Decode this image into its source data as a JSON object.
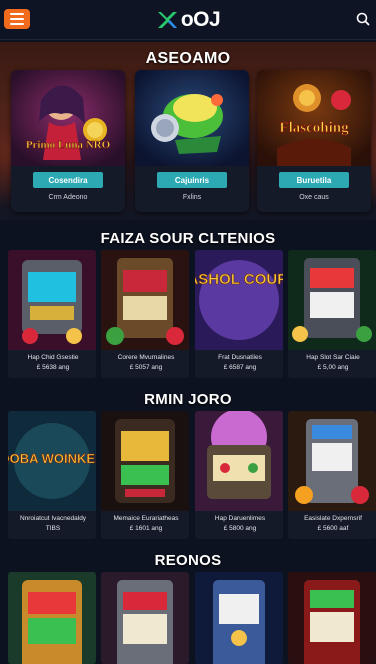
{
  "header": {
    "logo_text": "oOJ"
  },
  "sections": {
    "featured_title": "ASEOAMO",
    "row1_title": "FAIZA SOUR CLTENIOS",
    "row2_title": "RMIN JORO",
    "row3_title": "REONOS"
  },
  "featured": [
    {
      "art_text": "Primo Luna NRO",
      "button": "Cosendira",
      "caption": "Crm Adeono"
    },
    {
      "art_text": "",
      "button": "Cajuinris",
      "caption": "Fxlins"
    },
    {
      "art_text": "Flascohing",
      "button": "Buruetila",
      "caption": "Oxe caus"
    }
  ],
  "row1": [
    {
      "line1": "Hap Chid Gsestie",
      "line2": "£ 5638 ang"
    },
    {
      "line1": "Corere Mvurnalines",
      "line2": "£ 5057 ang"
    },
    {
      "line1": "Frat Dusnatiles",
      "line2": "£ 6587 ang"
    },
    {
      "line1": "Hap Slot Sar Ciaie",
      "line2": "£ 5,00 ang"
    }
  ],
  "row1_art": [
    "",
    "",
    "BONG RASHOL COURENZAND",
    ""
  ],
  "row2": [
    {
      "line1": "Nnroiatcut Ivacnedaldy",
      "line2": "TIBS"
    },
    {
      "line1": "Memaice Eurariatheas",
      "line2": "£ 1601 ang"
    },
    {
      "line1": "Hap Daruenlimes",
      "line2": "£ 5800 ang"
    },
    {
      "line1": "Easislate Dxpernsrif",
      "line2": "£ 5600 aaf"
    }
  ],
  "row2_art": [
    "SOOBA WOINKEED",
    "",
    "",
    ""
  ],
  "colors": {
    "accent": "#f26a1b",
    "button": "#2ca9b3",
    "bg": "#0d1220"
  },
  "icons": {
    "menu": "hamburger-icon",
    "search": "search-icon"
  }
}
